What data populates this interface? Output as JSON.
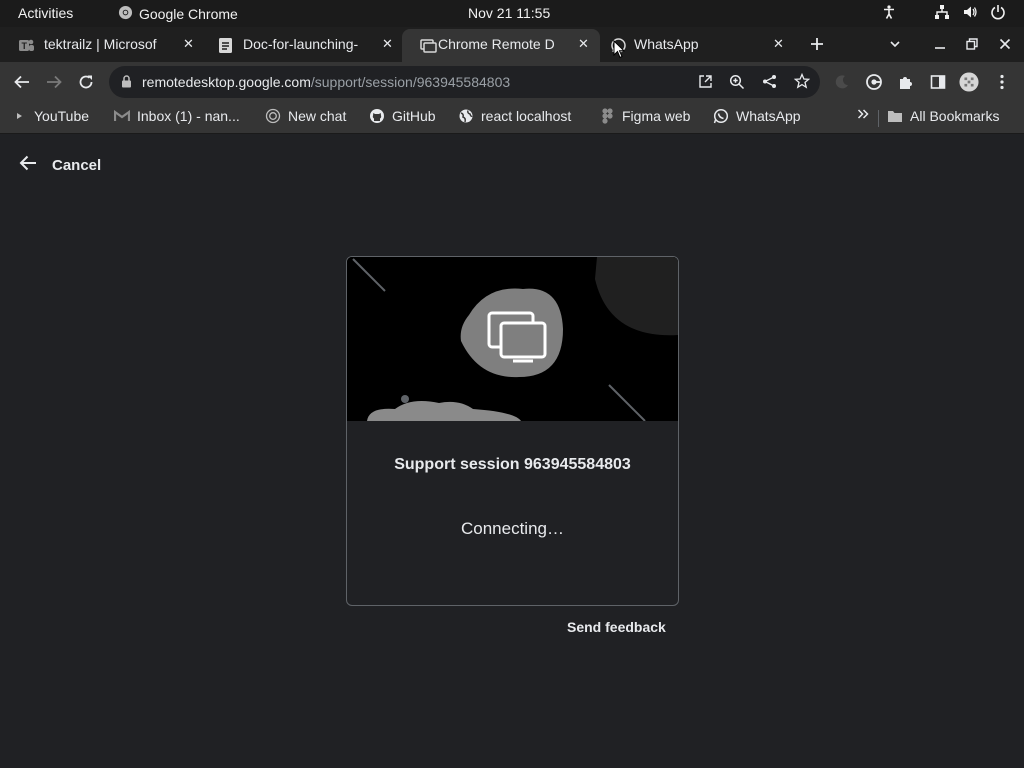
{
  "topbar": {
    "activities": "Activities",
    "app_name": "Google Chrome",
    "datetime": "Nov 21  11:55"
  },
  "tabs": [
    {
      "title": "tektrailz | Microsof",
      "icon": "teams-icon",
      "active": false
    },
    {
      "title": "Doc-for-launching-",
      "icon": "docs-icon",
      "active": false
    },
    {
      "title": "Chrome Remote De",
      "icon": "remote-desktop-icon",
      "active": true
    },
    {
      "title": "WhatsApp",
      "icon": "whatsapp-icon",
      "active": false
    }
  ],
  "toolbar": {
    "url_host": "remotedesktop.google.com",
    "url_path": "/support/session/963945584803"
  },
  "bookmarks": [
    {
      "label": "YouTube",
      "icon": "youtube-icon"
    },
    {
      "label": "Inbox (1) - nan...",
      "icon": "mail-icon"
    },
    {
      "label": "New chat",
      "icon": "chatgpt-icon"
    },
    {
      "label": "GitHub",
      "icon": "github-icon"
    },
    {
      "label": "react localhost",
      "icon": "globe-icon"
    },
    {
      "label": "Figma web",
      "icon": "figma-icon"
    },
    {
      "label": "WhatsApp",
      "icon": "whatsapp-icon"
    }
  ],
  "bookmarks_folder": "All Bookmarks",
  "page": {
    "cancel_label": "Cancel",
    "session_title": "Support session 963945584803",
    "status": "Connecting…",
    "feedback_label": "Send feedback"
  },
  "colors": {
    "page_bg": "#202124",
    "toolbar_bg": "#353535",
    "text": "#e8eaed",
    "hero_blob": "#7f7f7f"
  }
}
